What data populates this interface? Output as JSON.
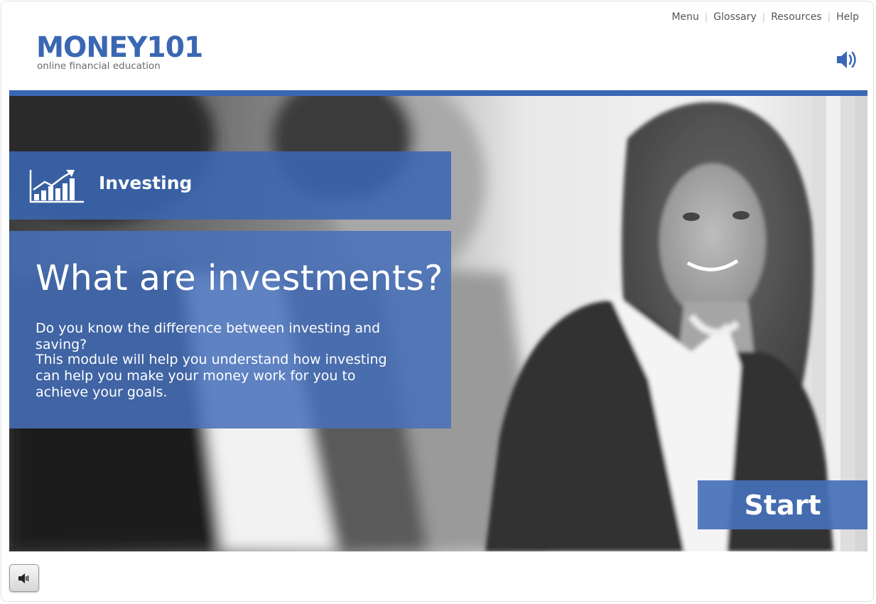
{
  "nav": {
    "items": [
      "Menu",
      "Glossary",
      "Resources",
      "Help"
    ]
  },
  "logo": {
    "wordmark": "MONEY101",
    "tagline": "online financial education"
  },
  "module": {
    "title": "Investing",
    "icon": "chart-growth-icon"
  },
  "content": {
    "heading": "What are investments?",
    "paragraph1": "Do you know the difference between investing and saving?",
    "paragraph2": "This module will help you understand how investing can help you make your money work for you to achieve your goals."
  },
  "start": {
    "label": "Start"
  },
  "icons": {
    "audio_top": "speaker-icon",
    "audio_bottom": "speaker-icon"
  },
  "colors": {
    "brand_blue": "#3a67b3",
    "panel_blue": "#4670ba"
  }
}
